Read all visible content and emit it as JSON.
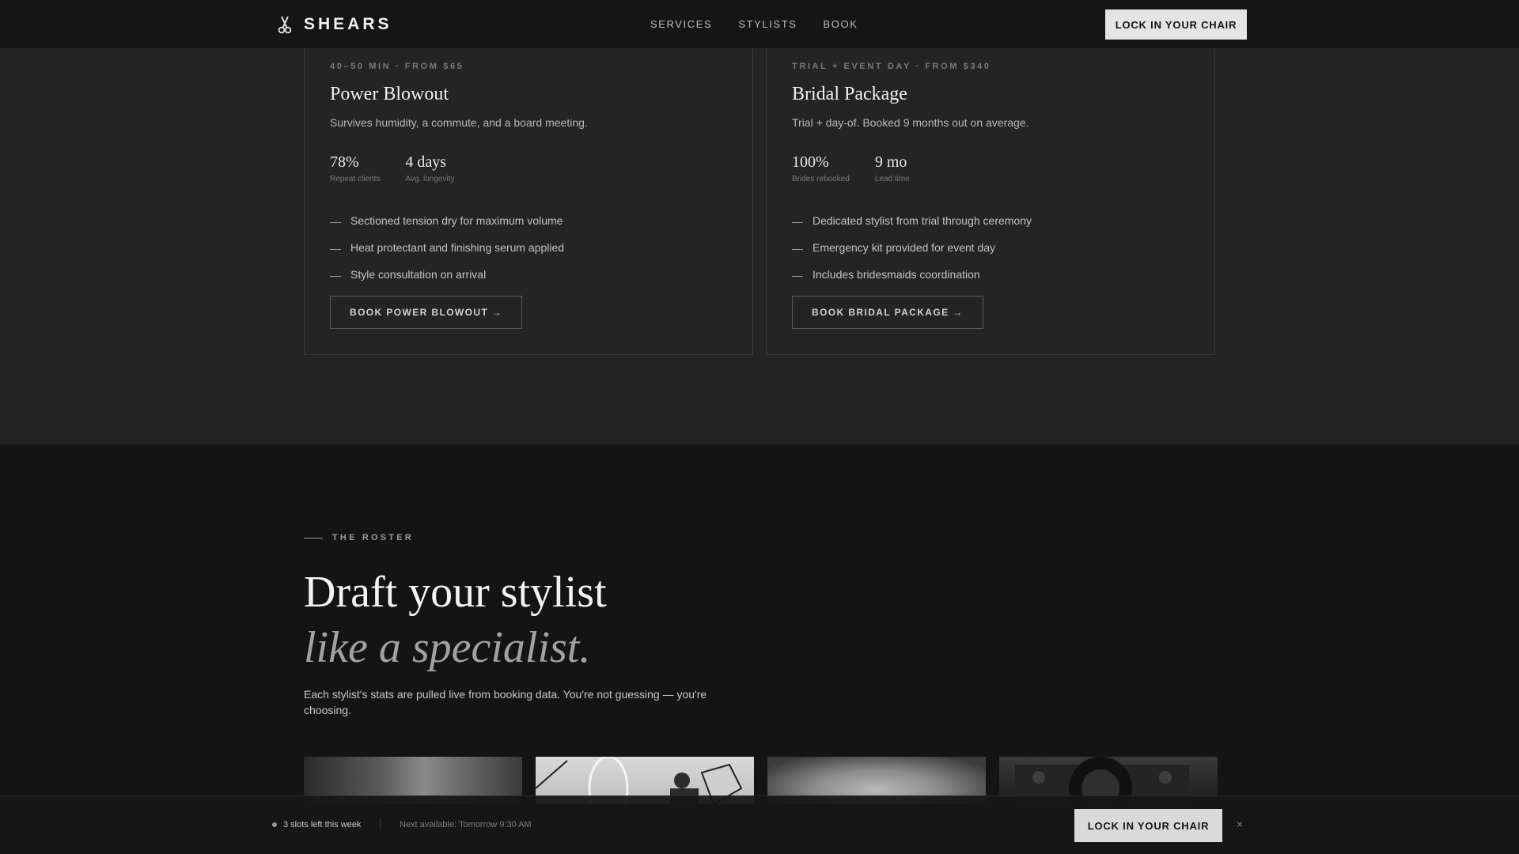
{
  "nav": {
    "brand": "SHEARS",
    "links": [
      "SERVICES",
      "STYLISTS",
      "BOOK"
    ],
    "cta": "LOCK IN YOUR CHAIR"
  },
  "services": {
    "cards": [
      {
        "meta": "40–50 MIN · FROM $65",
        "title": "Power Blowout",
        "description": "Survives humidity, a commute, and a board meeting.",
        "stats": [
          {
            "value": "78%",
            "label": "Repeat clients"
          },
          {
            "value": "4 days",
            "label": "Avg. longevity"
          }
        ],
        "features": [
          "Sectioned tension dry for maximum volume",
          "Heat protectant and finishing serum applied",
          "Style consultation on arrival"
        ],
        "button": "BOOK POWER BLOWOUT →"
      },
      {
        "meta": "TRIAL + EVENT DAY · FROM $340",
        "title": "Bridal Package",
        "description": "Trial + day-of. Booked 9 months out on average.",
        "stats": [
          {
            "value": "100%",
            "label": "Brides rebooked"
          },
          {
            "value": "9 mo",
            "label": "Lead time"
          }
        ],
        "features": [
          "Dedicated stylist from trial through ceremony",
          "Emergency kit provided for event day",
          "Includes bridesmaids coordination"
        ],
        "button": "BOOK BRIDAL PACKAGE →"
      }
    ]
  },
  "roster": {
    "eyebrow": "THE ROSTER",
    "headline": "Draft your stylist",
    "headline_italic": "like a specialist.",
    "lede": "Each stylist's stats are pulled live from booking data. You're not guessing — you're choosing."
  },
  "stickybar": {
    "slots": "3 slots left this week",
    "next": "Next available: Tomorrow 9:30 AM",
    "cta": "LOCK IN YOUR CHAIR",
    "close": "×"
  }
}
